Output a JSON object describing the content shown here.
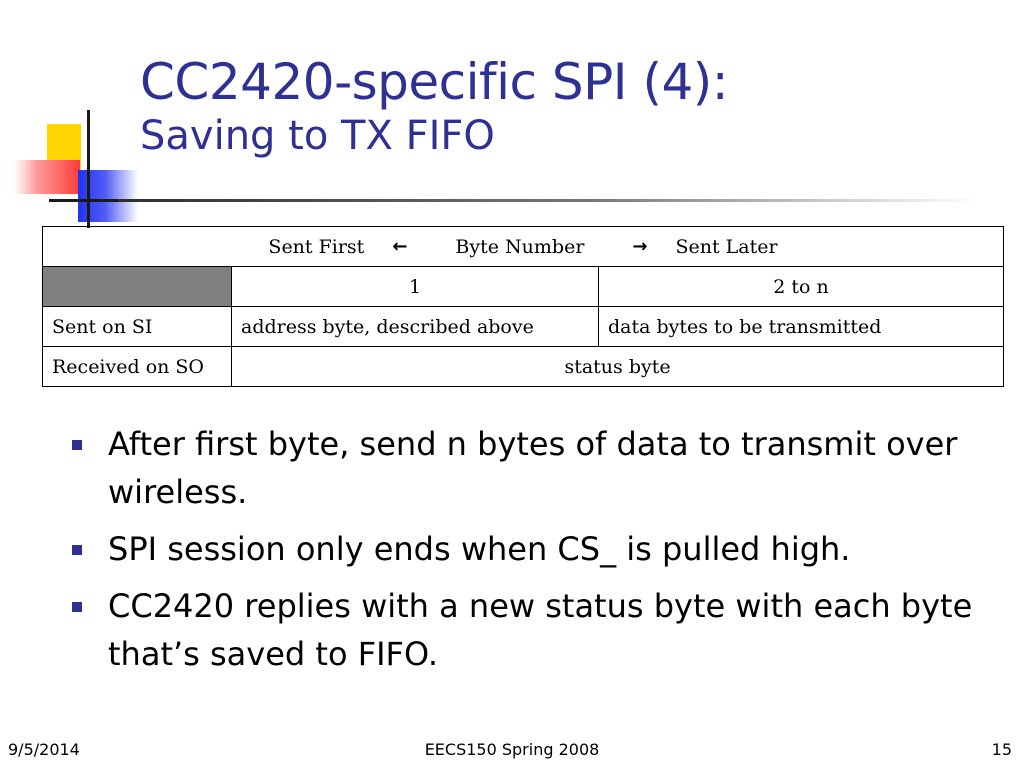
{
  "title": {
    "main": "CC2420-specific SPI (4):",
    "subtitle": "Saving to TX FIFO"
  },
  "table": {
    "header": {
      "sent_first": "Sent First",
      "left_arrow": "←",
      "byte_number": "Byte Number",
      "right_arrow": "→",
      "sent_later": "Sent Later"
    },
    "col_headers": [
      "1",
      "2 to n"
    ],
    "rows": [
      {
        "label": "Sent on SI",
        "cells": [
          "address byte, described above",
          "data bytes to be transmitted"
        ]
      },
      {
        "label": "Received on SO",
        "cells": [
          "status byte"
        ]
      }
    ]
  },
  "bullets": [
    "After first byte, send n bytes of data to transmit over wireless.",
    "SPI session only ends when CS_ is pulled high.",
    "CC2420 replies with a new status byte with each byte that’s saved to FIFO."
  ],
  "footer": {
    "date": "9/5/2014",
    "course": "EECS150 Spring 2008",
    "page": "15"
  },
  "colors": {
    "title": "#2e3191",
    "bullet": "#2e3191",
    "shade": "#808080"
  }
}
